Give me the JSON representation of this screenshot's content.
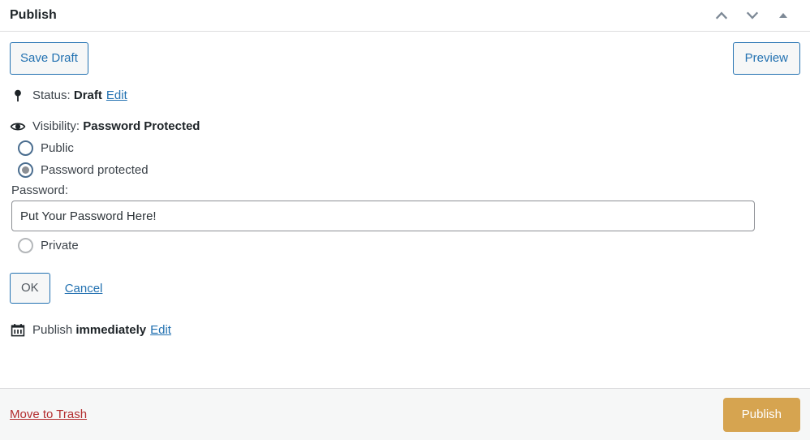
{
  "header": {
    "title": "Publish",
    "actions": [
      {
        "name": "move-up",
        "icon": "chevron-up-icon"
      },
      {
        "name": "move-down",
        "icon": "chevron-down-icon"
      },
      {
        "name": "toggle-panel",
        "icon": "triangle-up-icon"
      }
    ]
  },
  "toolbar": {
    "save_draft_label": "Save Draft",
    "preview_label": "Preview"
  },
  "status": {
    "icon": "pin-icon",
    "label": "Status:",
    "value": "Draft",
    "edit_label": "Edit"
  },
  "visibility": {
    "icon": "eye-icon",
    "label": "Visibility:",
    "value": "Password Protected",
    "options": [
      {
        "label": "Public",
        "selected": false
      },
      {
        "label": "Password protected",
        "selected": true
      },
      {
        "label": "Private",
        "selected": false
      }
    ],
    "password_label": "Password:",
    "password_value": "Put Your Password Here!",
    "password_placeholder": "",
    "ok_label": "OK",
    "cancel_label": "Cancel"
  },
  "publish_date": {
    "icon": "calendar-icon",
    "label": "Publish",
    "value": "immediately",
    "edit_label": "Edit"
  },
  "footer": {
    "trash_label": "Move to Trash",
    "publish_label": "Publish"
  },
  "colors": {
    "accent_blue": "#2271b1",
    "publish_gold": "#d6a450",
    "trash_red": "#b32d2e",
    "footer_bg": "#f6f7f7",
    "border": "#dcdcde"
  }
}
